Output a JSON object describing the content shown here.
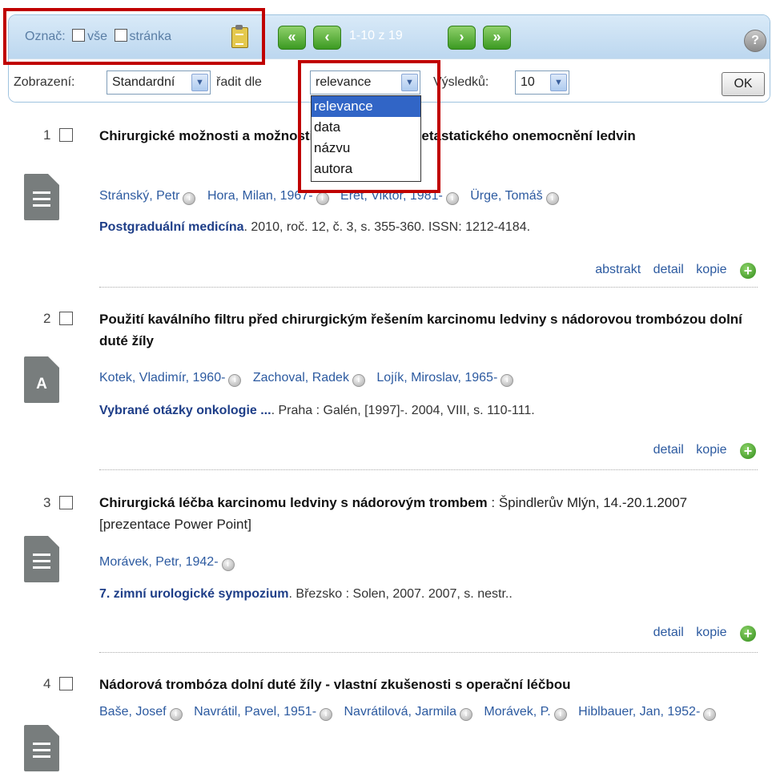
{
  "toolbar": {
    "mark_label": "Označ:",
    "mark_all": "vše",
    "mark_page": "stránka",
    "nav_first": "«",
    "nav_prev": "‹",
    "page_info": "1-10 z 19",
    "nav_next": "›",
    "nav_last": "»",
    "help": "?",
    "display_label": "Zobrazení:",
    "display_value": "Standardní",
    "sort_label": "řadit dle",
    "sort_value": "relevance",
    "results_label": "Výsledků:",
    "results_value": "10",
    "ok": "OK"
  },
  "sort_options": [
    "relevance",
    "data",
    "názvu",
    "autora"
  ],
  "records": [
    {
      "num": "1",
      "icon": "document-icon",
      "title": "Chirurgické možnosti a možnosti pokročilého a metastatického onemocnění ledvin",
      "title_rest": "",
      "authors": [
        "Stránský, Petr",
        "Hora, Milan, 1967-",
        "Eret, Viktor, 1981-",
        "Ürge, Tomáš"
      ],
      "source_bold": "Postgraduální medicína",
      "source_rest": ". 2010, roč. 12, č. 3, s. 355-360. ISSN: 1212-4184.",
      "actions": [
        "abstrakt",
        "detail",
        "kopie"
      ]
    },
    {
      "num": "2",
      "icon": "article-icon",
      "title": "Použití kaválního filtru před chirurgickým řešením karcinomu ledviny s nádorovou trombózou dolní duté žíly",
      "title_rest": "",
      "authors": [
        "Kotek, Vladimír, 1960-",
        "Zachoval, Radek",
        "Lojík, Miroslav, 1965-"
      ],
      "source_bold": "Vybrané otázky onkologie ...",
      "source_rest": ". Praha : Galén, [1997]-. 2004, VIII, s. 110-111.",
      "actions": [
        "detail",
        "kopie"
      ]
    },
    {
      "num": "3",
      "icon": "document-icon",
      "title": "Chirurgická léčba karcinomu ledviny s nádorovým trombem",
      "title_rest": " : Špindlerův Mlýn, 14.-20.1.2007 [prezentace Power Point]",
      "authors": [
        "Morávek, Petr, 1942-"
      ],
      "source_bold": "7. zimní urologické sympozium",
      "source_rest": ". Březsko : Solen, 2007. 2007, s. nestr..",
      "actions": [
        "detail",
        "kopie"
      ]
    },
    {
      "num": "4",
      "icon": "document-icon",
      "title": "Nádorová trombóza dolní duté žíly - vlastní zkušenosti s operační léčbou",
      "title_rest": "",
      "authors": [
        "Baše, Josef",
        "Navrátil, Pavel, 1951-",
        "Navrátilová, Jarmila",
        "Morávek, P.",
        "Hiblbauer, Jan, 1952-"
      ],
      "source_bold": "",
      "source_rest": "",
      "actions": []
    }
  ]
}
